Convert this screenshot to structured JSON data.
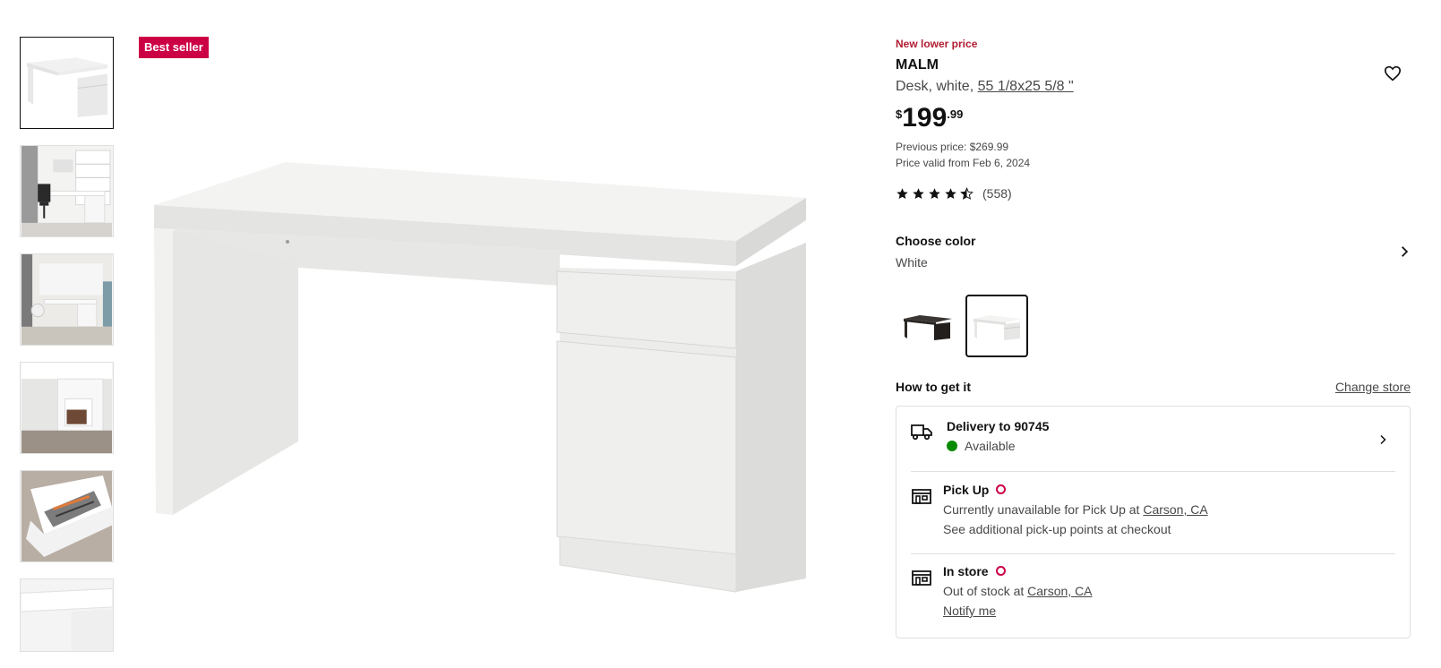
{
  "gallery": {
    "badge": "Best seller",
    "thumbnails": [
      "desk-white",
      "office-scene",
      "room-scene",
      "cabinet-closeup",
      "drawer-closeup",
      "desk-edge"
    ]
  },
  "product": {
    "promo_label": "New lower price",
    "name": "MALM",
    "description_prefix": "Desk, white, ",
    "size": "55 1/8x25 5/8 \"",
    "price": {
      "currency": "$",
      "integer": "199",
      "decimal": ".99"
    },
    "previous_price": "Previous price: $269.99",
    "price_valid": "Price valid from Feb 6, 2024",
    "rating": {
      "stars": 4.5,
      "count": "(558)"
    },
    "wishlist_icon": "heart-icon"
  },
  "color": {
    "title": "Choose color",
    "selected": "White",
    "options": [
      "black-brown",
      "white"
    ],
    "colors": {
      "black_brown": "#2b2724",
      "white": "#f2f2f0"
    }
  },
  "availability": {
    "title": "How to get it",
    "change_store": "Change store",
    "delivery": {
      "title": "Delivery to 90745",
      "status": "Available",
      "status_color": "#0a8a00"
    },
    "pickup": {
      "title": "Pick Up",
      "line1_prefix": "Currently unavailable for Pick Up at ",
      "store": "Carson, CA",
      "line2": "See additional pick-up points at checkout"
    },
    "instore": {
      "title": "In store",
      "line1_prefix": "Out of stock at ",
      "store": "Carson, CA",
      "notify": "Notify me"
    }
  },
  "colors": {
    "accent_red": "#cc0044",
    "promo_red": "#b01d33",
    "text_muted": "#484848"
  }
}
